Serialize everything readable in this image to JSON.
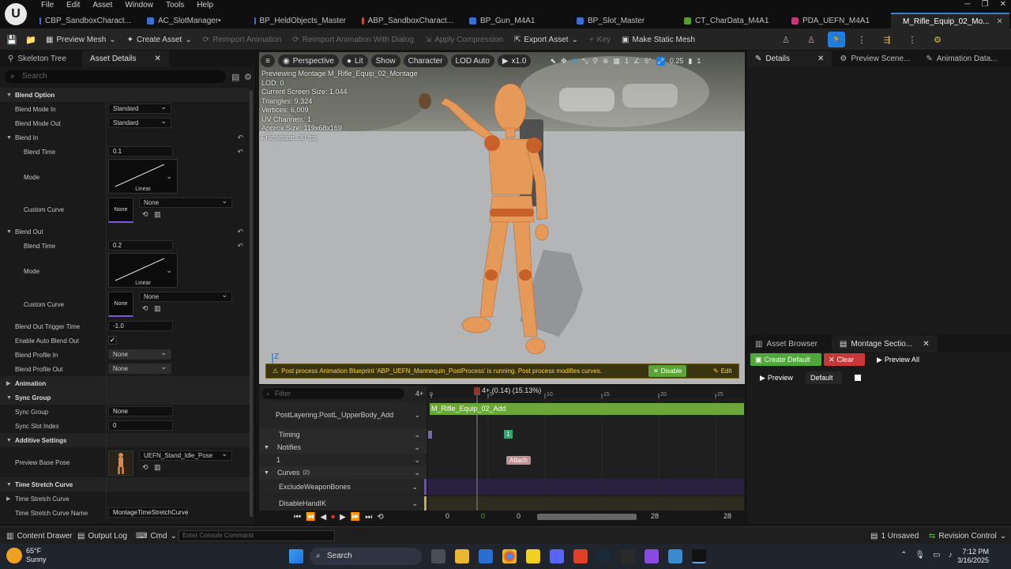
{
  "menu": [
    "File",
    "Edit",
    "Asset",
    "Window",
    "Tools",
    "Help"
  ],
  "tabs": [
    {
      "label": "CBP_SandboxCharact...",
      "color": "#3a6fd6",
      "active": false
    },
    {
      "label": "AC_SlotManager•",
      "color": "#3a6fd6",
      "active": false
    },
    {
      "label": "BP_HeldObjects_Master",
      "color": "#3a6fd6",
      "active": false
    },
    {
      "label": "ABP_SandboxCharact...",
      "color": "#c04a3a",
      "active": false
    },
    {
      "label": "BP_Gun_M4A1",
      "color": "#3a6fd6",
      "active": false
    },
    {
      "label": "BP_Slot_Master",
      "color": "#3a6fd6",
      "active": false
    },
    {
      "label": "CT_CharData_M4A1",
      "color": "#5a9a3a",
      "active": false
    },
    {
      "label": "PDA_UEFN_M4A1",
      "color": "#c03a7a",
      "active": false
    },
    {
      "label": "M_Rifle_Equip_02_Mo...",
      "color": "#7a5ad6",
      "active": true
    }
  ],
  "toolbar": {
    "preview_mesh": "Preview Mesh",
    "create_asset": "Create Asset",
    "reimport": "Reimport Animation",
    "reimport_dialog": "Reimport Animation With Dialog",
    "apply_compression": "Apply Compression",
    "export_asset": "Export Asset",
    "key": "Key",
    "make_static": "Make Static Mesh"
  },
  "left_panel": {
    "tab1": "Skeleton Tree",
    "tab2": "Asset Details",
    "search_placeholder": "Search",
    "blend_option": "Blend Option",
    "blend_mode_in": "Blend Mode In",
    "blend_mode_in_val": "Standard",
    "blend_mode_out": "Blend Mode Out",
    "blend_mode_out_val": "Standard",
    "blend_in": "Blend In",
    "blend_time": "Blend Time",
    "blend_in_time": "0.1",
    "mode": "Mode",
    "linear": "Linear",
    "custom_curve": "Custom Curve",
    "none": "None",
    "blend_out": "Blend Out",
    "blend_out_time": "0.2",
    "blend_out_trigger": "Blend Out Trigger Time",
    "blend_out_trigger_val": "-1.0",
    "enable_auto_blend_out": "Enable Auto Blend Out",
    "blend_profile_in": "Blend Profile In",
    "blend_profile_out": "Blend Profile Out",
    "animation": "Animation",
    "sync_group_cat": "Sync Group",
    "sync_group": "Sync Group",
    "sync_group_val": "None",
    "sync_slot_index": "Sync Slot Index",
    "sync_slot_index_val": "0",
    "additive_settings": "Additive Settings",
    "preview_base_pose": "Preview Base Pose",
    "preview_base_pose_val": "UEFN_Stand_Idle_Pose",
    "time_stretch_cat": "Time Stretch Curve",
    "time_stretch": "Time Stretch Curve",
    "time_stretch_name": "Time Stretch Curve Name",
    "time_stretch_name_val": "MontageTimeStretchCurve"
  },
  "viewport": {
    "perspective": "Perspective",
    "lit": "Lit",
    "show": "Show",
    "character": "Character",
    "lod": "LOD Auto",
    "speed": "x1.0",
    "grid_val": "1",
    "angle_val": "5°",
    "scale_val": "0.25",
    "cam_val": "1",
    "stats": [
      "Previewing Montage M_Rifle_Equip_02_Montage",
      "LOD: 0",
      "Current Screen Size: 1.044",
      "Triangles: 9,324",
      "Vertices: 6,009",
      "UV Channels: 1",
      "Approx Size: 119x68x169",
      "Framerate: 30 fps"
    ],
    "banner": "Post process Animation Blueprint 'ABP_UEFN_Mannequin_PostProcess' is running. Post process modifies curves.",
    "disable": "Disable",
    "edit": "Edit",
    "axis": "Z"
  },
  "timeline": {
    "filter_placeholder": "Filter",
    "counter": "4+",
    "playhead": "4+ (0.14) (15.13%)",
    "slot": "PostLayering.PostL_UpperBody_Add",
    "montage_bar": "M_Rifle_Equip_02_Add",
    "timing": "Timing",
    "timing_marker": "1",
    "notifies": "Notifies",
    "notify_track": "1",
    "notify_label": "Attach",
    "curves": "Curves",
    "curves_count": "(2)",
    "curve1": "ExcludeWeaponBones",
    "curve2": "DisableHandIK",
    "ticks": [
      "0",
      "5",
      "10",
      "15",
      "20",
      "25"
    ],
    "range_start": "0",
    "range_green": "0",
    "range_cur": "0",
    "range_end": "28",
    "range_end2": "28"
  },
  "right": {
    "details_tab": "Details",
    "preview_scene_tab": "Preview Scene...",
    "anim_data_tab": "Animation Data...",
    "asset_browser_tab": "Asset Browser",
    "montage_tab": "Montage Sectio...",
    "create_default": "Create Default",
    "clear": "Clear",
    "preview_all": "Preview All",
    "preview": "Preview",
    "default": "Default"
  },
  "status": {
    "content_drawer": "Content Drawer",
    "output_log": "Output Log",
    "cmd": "Cmd",
    "console_placeholder": "Enter Console Command",
    "unsaved": "1 Unsaved",
    "revision": "Revision Control"
  },
  "taskbar": {
    "temp": "65°F",
    "weather": "Sunny",
    "search": "Search",
    "time": "7:12 PM",
    "date": "3/16/2025"
  }
}
